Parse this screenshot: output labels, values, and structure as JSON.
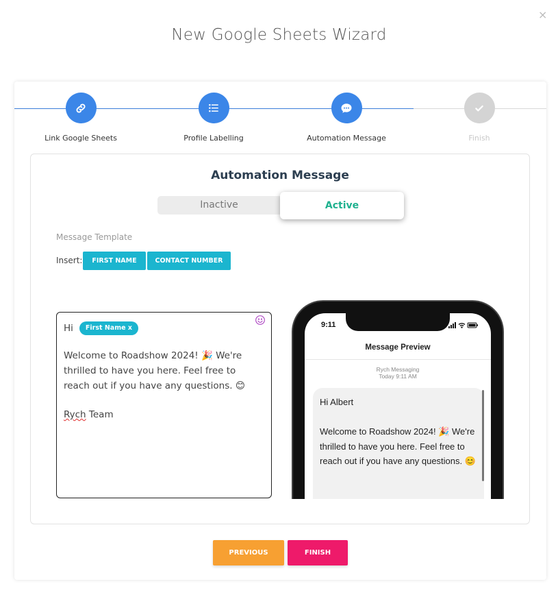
{
  "dialog": {
    "title": "New Google Sheets Wizard",
    "close_glyph": "×"
  },
  "stepper": {
    "steps": [
      {
        "label": "Link Google Sheets",
        "icon": "link-icon",
        "state": "completed"
      },
      {
        "label": "Profile Labelling",
        "icon": "list-icon",
        "state": "completed"
      },
      {
        "label": "Automation Message",
        "icon": "chat-bubble-icon",
        "state": "current"
      },
      {
        "label": "Finish",
        "icon": "check-icon",
        "state": "pending"
      }
    ]
  },
  "automation": {
    "title": "Automation Message",
    "toggle": {
      "inactive_label": "Inactive",
      "active_label": "Active",
      "selected": "Active"
    },
    "template_label": "Message Template",
    "insert_label": "Insert:",
    "insert_buttons": [
      "FIRST NAME",
      "CONTACT NUMBER"
    ]
  },
  "editor": {
    "greeting": "Hi",
    "chip_label": "First Name x",
    "body": "Welcome to Roadshow 2024! 🎉 We're thrilled to have you here. Feel free to reach out if you have any questions. 😊",
    "signature_word1": "Rych",
    "signature_word2": " Team"
  },
  "preview": {
    "time": "9:11",
    "title": "Message Preview",
    "sender": "Rych Messaging",
    "timestamp": "Today 9:11 AM",
    "greeting": "Hi Albert",
    "body": "Welcome to Roadshow 2024! 🎉 We're thrilled to have you here. Feel free to reach out if you have any questions. 😊"
  },
  "footer": {
    "previous_label": "PREVIOUS",
    "finish_label": "FINISH"
  },
  "colors": {
    "accent_blue": "#3b86e8",
    "teal": "#1bb5cf",
    "active_green": "#1fb18f",
    "orange": "#f7a032",
    "pink": "#ee1a6a"
  }
}
